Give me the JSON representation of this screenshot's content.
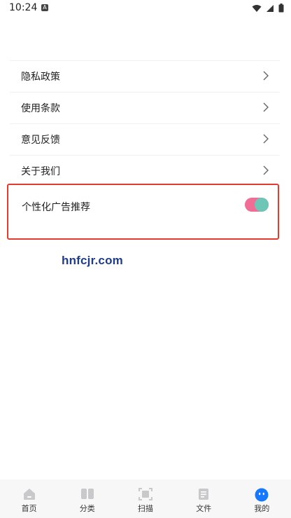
{
  "status_bar": {
    "time": "10:24",
    "notification_glyph": "A"
  },
  "menu": {
    "items": [
      {
        "label": "隐私政策"
      },
      {
        "label": "使用条款"
      },
      {
        "label": "意见反馈"
      },
      {
        "label": "关于我们"
      }
    ]
  },
  "ad_setting": {
    "label": "个性化广告推荐",
    "enabled": true
  },
  "watermark": "hnfcjr.com",
  "bottom_nav": {
    "items": [
      {
        "label": "首页",
        "icon": "home-icon"
      },
      {
        "label": "分类",
        "icon": "book-icon"
      },
      {
        "label": "扫描",
        "icon": "scan-icon"
      },
      {
        "label": "文件",
        "icon": "document-icon"
      },
      {
        "label": "我的",
        "icon": "profile-icon"
      }
    ],
    "active_index": 4
  },
  "colors": {
    "highlight_border": "#e53a2e",
    "toggle_track": "#f06e95",
    "toggle_knob": "#6ec6b6",
    "active_nav": "#1677ff",
    "watermark": "#1f3c8c"
  }
}
